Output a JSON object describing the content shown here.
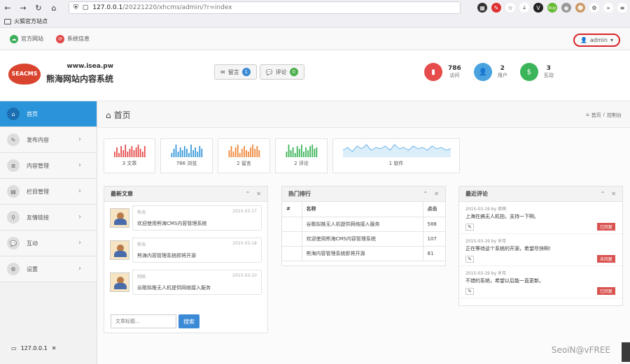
{
  "browser": {
    "url_main": "127.0.0.1",
    "url_rest": "/20221220/xhcms/admin/?r=index",
    "bookmark": "火狐官方站点",
    "ext_labels": [
      "buy"
    ]
  },
  "topbar": {
    "links": [
      {
        "label": "官方网站",
        "color": "#3cae5b"
      },
      {
        "label": "系统信息",
        "color": "#e24a4a"
      }
    ],
    "admin": "admin"
  },
  "header": {
    "logo_badge": "SEACMS",
    "logo_url": "www.isea.pw",
    "logo_name": "熊海网站内容系统",
    "message_btn": {
      "label": "留言",
      "count": "1",
      "color": "#3a8ad6"
    },
    "comment_btn": {
      "label": "评论",
      "count": "0",
      "color": "#4cae4c"
    },
    "stats": [
      {
        "num": "786",
        "label": "访问",
        "color": "#e74c4c"
      },
      {
        "num": "2",
        "label": "用户",
        "color": "#4aa3df"
      },
      {
        "num": "3",
        "label": "互动",
        "color": "#3cb55a"
      }
    ]
  },
  "sidebar": {
    "items": [
      {
        "label": "首页",
        "active": true
      },
      {
        "label": "发布内容"
      },
      {
        "label": "内容管理"
      },
      {
        "label": "栏目管理"
      },
      {
        "label": "友情链接"
      },
      {
        "label": "互动"
      },
      {
        "label": "设置"
      }
    ]
  },
  "page": {
    "title": "首页",
    "breadcrumb_home": "首页",
    "breadcrumb_sep": "/",
    "breadcrumb_current": "控制台"
  },
  "minicharts": [
    {
      "label": "3 文章",
      "color": "#e74c4c",
      "type": "bar",
      "values": [
        4,
        7,
        3,
        8,
        5,
        9,
        4,
        6,
        8,
        5,
        7,
        9,
        6,
        4,
        8
      ]
    },
    {
      "label": "786 浏览",
      "color": "#3a9ad9",
      "type": "bar",
      "values": [
        3,
        6,
        9,
        4,
        7,
        5,
        8,
        6,
        3,
        9,
        5,
        7,
        4,
        8,
        6
      ]
    },
    {
      "label": "2 留言",
      "color": "#f0883a",
      "type": "bar",
      "values": [
        5,
        8,
        4,
        7,
        9,
        3,
        6,
        8,
        5,
        4,
        7,
        9,
        6,
        8,
        5
      ]
    },
    {
      "label": "2 评论",
      "color": "#3cb55a",
      "type": "bar",
      "values": [
        4,
        9,
        5,
        7,
        3,
        8,
        6,
        9,
        4,
        7,
        5,
        8,
        9,
        6,
        7
      ]
    },
    {
      "label": "1 软件",
      "color": "#6fb6e9",
      "type": "line",
      "values": [
        5,
        7,
        4,
        8,
        6,
        9,
        5,
        7,
        6,
        8,
        5,
        9,
        6,
        7,
        5,
        8,
        6,
        7,
        5,
        8,
        6,
        7,
        5,
        6
      ]
    }
  ],
  "latest": {
    "title": "最新文章",
    "articles": [
      {
        "author": "熊海",
        "date": "2015-03-17",
        "title": "欢迎使用熊海CMS内容管理系统"
      },
      {
        "author": "熊海",
        "date": "2015-03-18",
        "title": "熊海内容管理系统即将开源"
      },
      {
        "author": "网络",
        "date": "2015-03-10",
        "title": "谷歌拟推无人机提供网络接入服务"
      }
    ],
    "search_placeholder": "文章标题...",
    "search_btn": "搜索"
  },
  "hot": {
    "title": "热门排行",
    "headers": [
      "#",
      "名称",
      "点击"
    ],
    "rows": [
      {
        "name": "谷歌拟推无人机提供网络接入服务",
        "hits": "588"
      },
      {
        "name": "欢迎使用熊海CMS内容管理系统",
        "hits": "107"
      },
      {
        "name": "熊海内容管理系统即将开源",
        "hits": "81"
      }
    ]
  },
  "recent": {
    "title": "最近评论",
    "comments": [
      {
        "meta": "2015-03-19 by 卖萌",
        "text": "上海在搞无人机拍，支持一下啊。",
        "tag": "已回复"
      },
      {
        "meta": "2015-03-19 by 岁月",
        "text": "正在等待这个系统的开源，希望尽快啊!",
        "tag": "未回复"
      },
      {
        "meta": "2015-03-19 by 岁月",
        "text": "不错的系统，希望以后能一直更新。",
        "tag": "已回复"
      }
    ]
  },
  "footer": {
    "tab": "127.0.0.1",
    "watermark": "SeoiN@vFREE"
  }
}
